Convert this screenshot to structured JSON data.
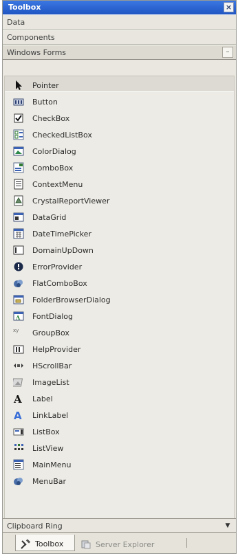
{
  "window": {
    "title": "Toolbox",
    "close_glyph": "×"
  },
  "sections": [
    {
      "label": "Data"
    },
    {
      "label": "Components"
    },
    {
      "label": "Windows Forms",
      "collapse_glyph": "–"
    }
  ],
  "items": [
    {
      "label": "Pointer",
      "icon": "pointer-icon"
    },
    {
      "label": "Button",
      "icon": "button-icon"
    },
    {
      "label": "CheckBox",
      "icon": "checkbox-icon"
    },
    {
      "label": "CheckedListBox",
      "icon": "checkedlistbox-icon"
    },
    {
      "label": "ColorDialog",
      "icon": "colordialog-icon"
    },
    {
      "label": "ComboBox",
      "icon": "combobox-icon"
    },
    {
      "label": "ContextMenu",
      "icon": "contextmenu-icon"
    },
    {
      "label": "CrystalReportViewer",
      "icon": "crystalreportviewer-icon"
    },
    {
      "label": "DataGrid",
      "icon": "datagrid-icon"
    },
    {
      "label": "DateTimePicker",
      "icon": "datetimepicker-icon"
    },
    {
      "label": "DomainUpDown",
      "icon": "domainupdown-icon"
    },
    {
      "label": "ErrorProvider",
      "icon": "errorprovider-icon"
    },
    {
      "label": "FlatComboBox",
      "icon": "flatcombobox-icon"
    },
    {
      "label": "FolderBrowserDialog",
      "icon": "folderbrowserdialog-icon"
    },
    {
      "label": "FontDialog",
      "icon": "fontdialog-icon"
    },
    {
      "label": "GroupBox",
      "icon": "groupbox-icon"
    },
    {
      "label": "HelpProvider",
      "icon": "helpprovider-icon"
    },
    {
      "label": "HScrollBar",
      "icon": "hscrollbar-icon"
    },
    {
      "label": "ImageList",
      "icon": "imagelist-icon"
    },
    {
      "label": "Label",
      "icon": "label-icon"
    },
    {
      "label": "LinkLabel",
      "icon": "linklabel-icon"
    },
    {
      "label": "ListBox",
      "icon": "listbox-icon"
    },
    {
      "label": "ListView",
      "icon": "listview-icon"
    },
    {
      "label": "MainMenu",
      "icon": "mainmenu-icon"
    },
    {
      "label": "MenuBar",
      "icon": "menubar-icon"
    }
  ],
  "footer_section": {
    "label": "Clipboard Ring",
    "scroll_glyph": "▼"
  },
  "bottom_tabs": [
    {
      "label": "Toolbox",
      "icon": "hammer-icon",
      "active": true
    },
    {
      "label": "Server Explorer",
      "icon": "server-icon",
      "active": false
    }
  ],
  "colors": {
    "titlebar": "#2a64d6",
    "panel": "#e9e7df",
    "accent_icon": "#3c62b4"
  }
}
